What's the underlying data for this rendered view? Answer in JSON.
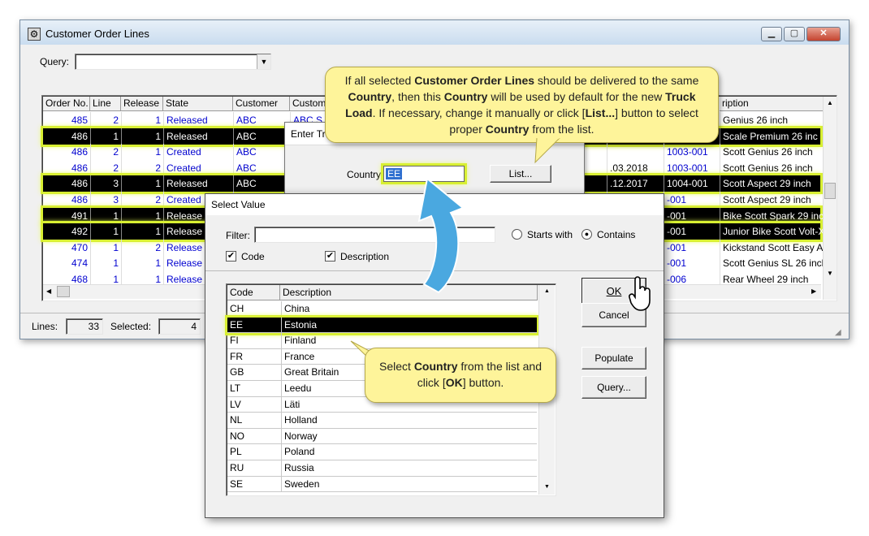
{
  "main_window": {
    "title": "Customer Order Lines",
    "query_label": "Query:",
    "query_value": "",
    "columns": [
      "Order No.",
      "Line",
      "Release",
      "State",
      "Customer",
      "Custom",
      "ription"
    ],
    "rows": [
      {
        "order": "485",
        "line": "2",
        "release": "1",
        "state": "Released",
        "customer": "ABC",
        "custom": "ABC S",
        "date": "",
        "part": "",
        "desc": "Genius 26 inch",
        "style": "blue"
      },
      {
        "order": "486",
        "line": "1",
        "release": "1",
        "state": "Released",
        "customer": "ABC",
        "custom": "",
        "date": "",
        "part": "",
        "desc": "Scale Premium 26 inc",
        "style": "sel"
      },
      {
        "order": "486",
        "line": "2",
        "release": "1",
        "state": "Created",
        "customer": "ABC",
        "custom": "",
        "date": "",
        "part": "1003-001",
        "desc": "Scott Genius 26 inch",
        "style": "blue"
      },
      {
        "order": "486",
        "line": "2",
        "release": "2",
        "state": "Created",
        "customer": "ABC",
        "custom": "",
        "date": ".03.2018",
        "part": "1003-001",
        "desc": "Scott Genius 26 inch",
        "style": "blue"
      },
      {
        "order": "486",
        "line": "3",
        "release": "1",
        "state": "Released",
        "customer": "ABC",
        "custom": "",
        "date": ".12.2017",
        "part": "1004-001",
        "desc": "Scott Aspect 29 inch",
        "style": "sel"
      },
      {
        "order": "486",
        "line": "3",
        "release": "2",
        "state": "Created",
        "customer": "",
        "custom": "",
        "date": "",
        "part": "-001",
        "desc": "Scott Aspect 29 inch",
        "style": "blue"
      },
      {
        "order": "491",
        "line": "1",
        "release": "1",
        "state": "Release",
        "customer": "",
        "custom": "",
        "date": "",
        "part": "-001",
        "desc": "Bike Scott Spark 29 inch",
        "style": "sel"
      },
      {
        "order": "492",
        "line": "1",
        "release": "1",
        "state": "Release",
        "customer": "",
        "custom": "",
        "date": "",
        "part": "-001",
        "desc": "Junior Bike Scott Volt-X 26",
        "style": "sel"
      },
      {
        "order": "470",
        "line": "1",
        "release": "2",
        "state": "Release",
        "customer": "",
        "custom": "",
        "date": "",
        "part": "-001",
        "desc": "Kickstand Scott Easy Adjus",
        "style": "blue"
      },
      {
        "order": "474",
        "line": "1",
        "release": "1",
        "state": "Release",
        "customer": "",
        "custom": "",
        "date": "",
        "part": "-001",
        "desc": "Scott Genius SL 26 inch",
        "style": "blue"
      },
      {
        "order": "468",
        "line": "1",
        "release": "1",
        "state": "Release",
        "customer": "",
        "custom": "",
        "date": "",
        "part": "-006",
        "desc": "Rear Wheel 29 inch",
        "style": "blue"
      }
    ],
    "status": {
      "lines_label": "Lines:",
      "lines_value": "33",
      "selected_label": "Selected:",
      "selected_value": "4"
    }
  },
  "enter_dialog": {
    "title": "Enter Tr",
    "country_label": "Country:",
    "country_value": "EE",
    "list_button": "List..."
  },
  "select_dialog": {
    "title": "Select Value",
    "filter_label": "Filter:",
    "filter_value": "",
    "starts_with_label": "Starts with",
    "contains_label": "Contains",
    "code_label": "Code",
    "description_label": "Description",
    "columns": [
      "Code",
      "Description"
    ],
    "rows": [
      {
        "code": "CH",
        "desc": "China",
        "selected": false
      },
      {
        "code": "EE",
        "desc": "Estonia",
        "selected": true
      },
      {
        "code": "FI",
        "desc": "Finland",
        "selected": false
      },
      {
        "code": "FR",
        "desc": "France",
        "selected": false
      },
      {
        "code": "GB",
        "desc": "Great Britain",
        "selected": false
      },
      {
        "code": "LT",
        "desc": "Leedu",
        "selected": false
      },
      {
        "code": "LV",
        "desc": "Läti",
        "selected": false
      },
      {
        "code": "NL",
        "desc": "Holland",
        "selected": false
      },
      {
        "code": "NO",
        "desc": "Norway",
        "selected": false
      },
      {
        "code": "PL",
        "desc": "Poland",
        "selected": false
      },
      {
        "code": "RU",
        "desc": "Russia",
        "selected": false
      },
      {
        "code": "SE",
        "desc": "Sweden",
        "selected": false
      }
    ],
    "buttons": {
      "ok": "OK",
      "cancel": "Cancel",
      "populate": "Populate",
      "query": "Query..."
    }
  },
  "callouts": {
    "top": [
      "If all selected ",
      "Customer Order Lines",
      " should be delivered to the same ",
      "Country",
      ", then this ",
      "Country",
      " will be used by default for the new ",
      "Truck Load",
      ".  If necessary, change it manually or click [",
      "List...",
      "] button to select proper ",
      "Country",
      " from the list."
    ],
    "bottom": [
      "Select ",
      "Country",
      " from the list and click [",
      "OK",
      "] button."
    ]
  },
  "colors": {
    "highlight": "#d8ef32",
    "callout": "#fef49a",
    "arrow": "#4aa8e0",
    "link_blue": "#0000d0"
  }
}
